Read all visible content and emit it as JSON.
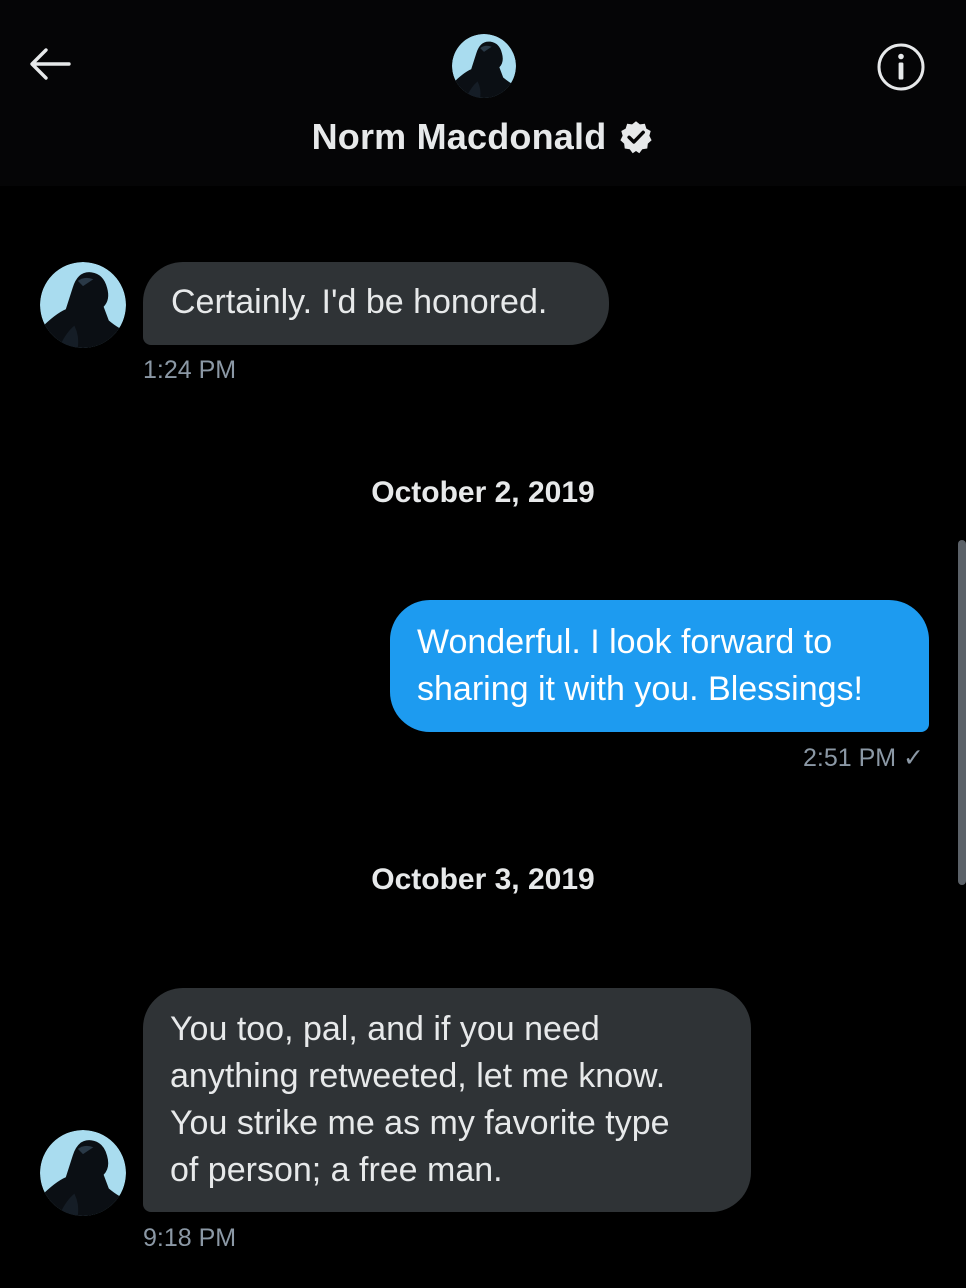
{
  "header": {
    "contact_name": "Norm Macdonald",
    "verified": true,
    "back_icon": "arrow-left-icon",
    "info_icon": "info-icon"
  },
  "messages": [
    {
      "direction": "incoming",
      "text": "Certainly. I'd be honored.",
      "time": "1:24 PM"
    },
    {
      "type": "date-separator",
      "text": "October 2, 2019"
    },
    {
      "direction": "outgoing",
      "lines": [
        "Wonderful. I look forward to",
        "sharing it with you. Blessings!"
      ],
      "time": "2:51 PM ✓"
    },
    {
      "type": "date-separator",
      "text": "October 3, 2019"
    },
    {
      "direction": "incoming",
      "lines": [
        "You too, pal, and if you need",
        "anything retweeted, let me know.",
        "You strike me as my favorite type",
        "of person; a free man."
      ],
      "time": "9:18 PM"
    }
  ],
  "colors": {
    "background": "#000000",
    "incoming_bubble": "#2f3336",
    "outgoing_bubble": "#1d9bf0",
    "timestamp": "#8b98a5",
    "avatar_sky": "#9fd8ef"
  }
}
